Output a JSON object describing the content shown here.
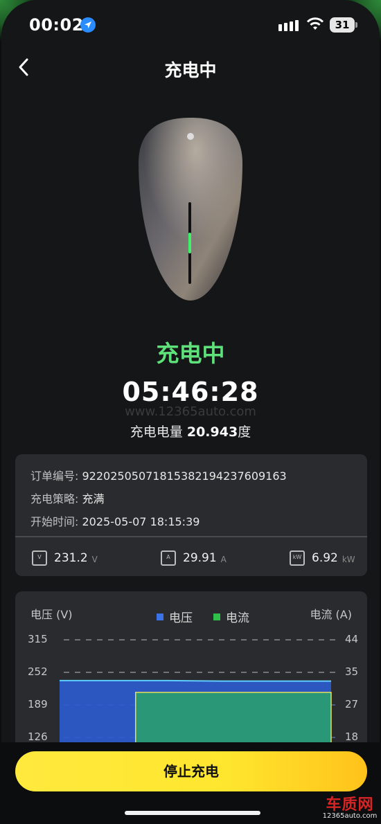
{
  "status_bar": {
    "time": "00:02",
    "battery": "31"
  },
  "nav": {
    "title": "充电中"
  },
  "charging": {
    "status": "充电中",
    "duration": "05:46:28",
    "watermark": "www.12365auto.com",
    "energy_label": "充电电量",
    "energy_value": "20.943",
    "energy_unit": "度"
  },
  "info": {
    "order_label": "订单编号:",
    "order_value": "92202505071815382194237609163",
    "strategy_label": "充电策略:",
    "strategy_value": "充满",
    "start_label": "开始时间:",
    "start_value": "2025-05-07 18:15:39"
  },
  "metrics": [
    {
      "icon": "voltage-meter-icon",
      "value": "231.2",
      "unit": "V"
    },
    {
      "icon": "current-meter-icon",
      "value": "29.91",
      "unit": "A"
    },
    {
      "icon": "power-meter-icon",
      "value": "6.92",
      "unit": "kW"
    }
  ],
  "chart_data": {
    "type": "area",
    "left_axis_title": "电压 (V)",
    "right_axis_title": "电流 (A)",
    "left_ticks": [
      "315",
      "252",
      "189",
      "126"
    ],
    "right_ticks": [
      "44",
      "35",
      "27",
      "18"
    ],
    "series": [
      {
        "name": "电压",
        "color": "#3a72e8",
        "axis": "left",
        "values": [
          236,
          236,
          236,
          235,
          235,
          235
        ]
      },
      {
        "name": "电流",
        "color": "#2fc04a",
        "axis": "right",
        "values": [
          0,
          0,
          30,
          30,
          30,
          30
        ]
      }
    ],
    "ylim_left": [
      126,
      315
    ],
    "ylim_right": [
      18,
      44
    ],
    "grid": true,
    "legend_position": "top-center"
  },
  "actions": {
    "stop_label": "停止充电"
  },
  "brand": {
    "name": "车质网",
    "url": "12365auto.com"
  },
  "colors": {
    "accent_green": "#5ee07a",
    "button_yellow": "#ffe62e"
  }
}
